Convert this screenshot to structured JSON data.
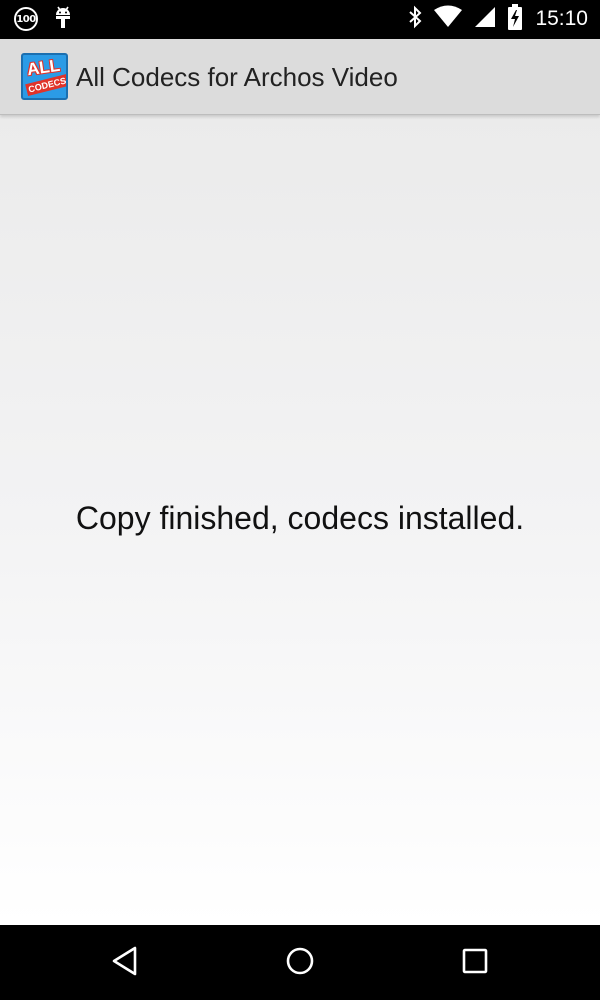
{
  "status_bar": {
    "badge": "100",
    "time": "15:10",
    "icons": [
      "android-icon",
      "bluetooth-icon",
      "wifi-icon",
      "signal-icon",
      "battery-charging-icon"
    ]
  },
  "action_bar": {
    "logo_top_text": "ALL",
    "logo_bottom_text": "CODECS",
    "title": "All Codecs for Archos Video"
  },
  "content": {
    "message": "Copy finished, codecs installed."
  },
  "nav_bar": {
    "buttons": [
      "back-icon",
      "home-icon",
      "recents-icon"
    ]
  },
  "colors": {
    "status_bar_bg": "#000000",
    "action_bar_bg": "#dcdcdc",
    "logo_blue": "#2b9be6",
    "logo_red": "#e0332a",
    "nav_bar_bg": "#000000"
  }
}
